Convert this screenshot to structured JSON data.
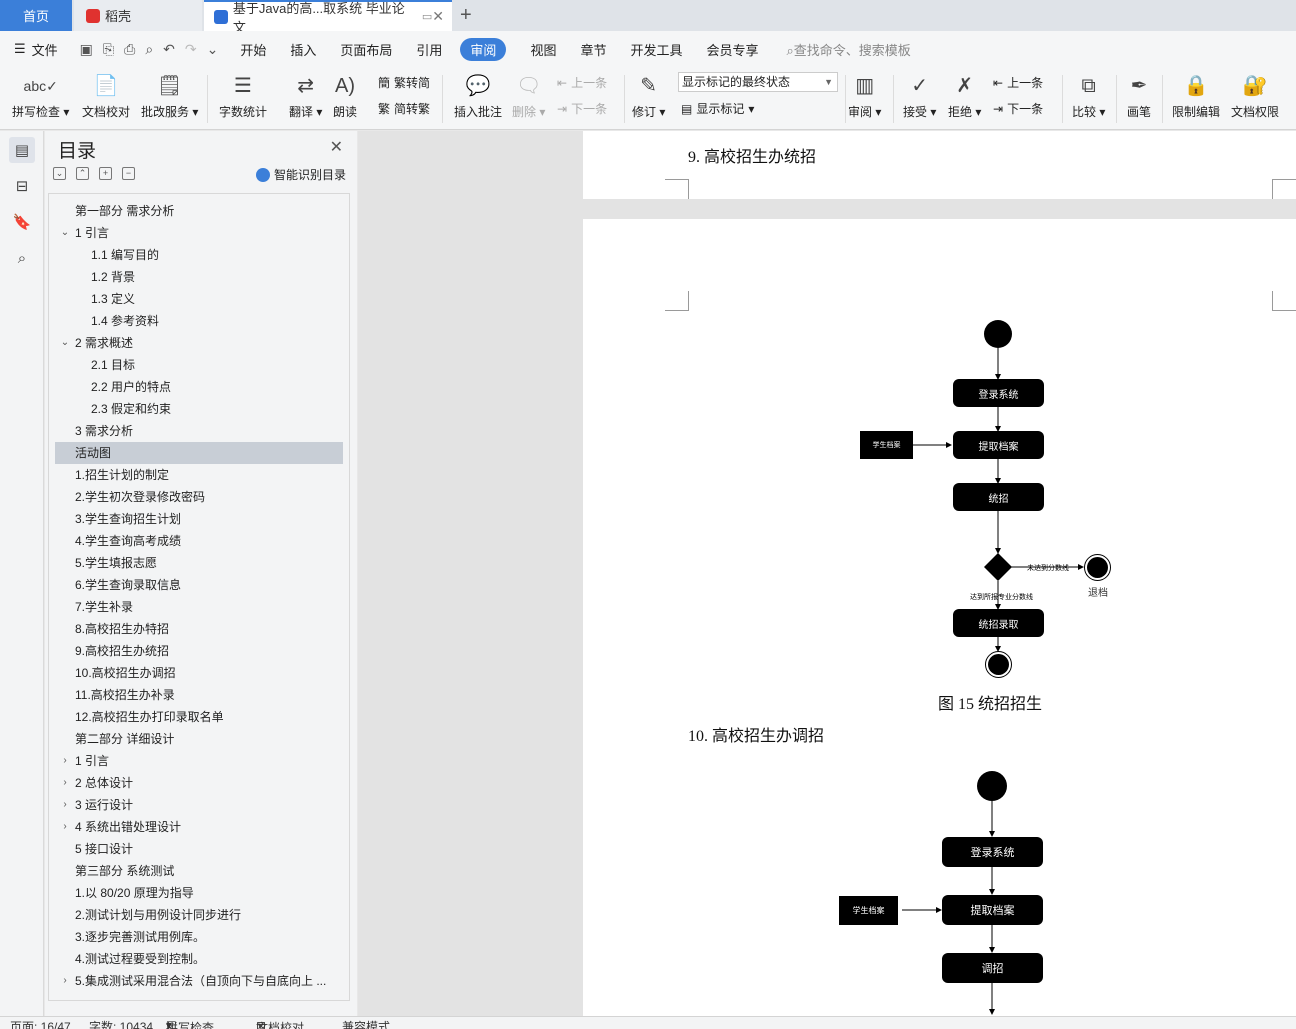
{
  "tabs": {
    "home": "首页",
    "daoke": "稻壳",
    "doc": "基于Java的高...取系统 毕业论文"
  },
  "menu": {
    "file": "文件",
    "items": [
      "开始",
      "插入",
      "页面布局",
      "引用",
      "审阅",
      "视图",
      "章节",
      "开发工具",
      "会员专享"
    ],
    "active": "审阅",
    "search": "查找命令、搜索模板"
  },
  "ribbon": {
    "spell": "拼写检查",
    "doc_check": "文档校对",
    "revise_service": "批改服务",
    "word_count": "字数统计",
    "translate": "翻译",
    "read": "朗读",
    "trad_simp": "繁转简",
    "simp_trad": "简转繁",
    "insert_comment": "插入批注",
    "delete": "删除",
    "prev": "上一条",
    "next": "下一条",
    "track": "修订",
    "markup_state": "显示标记的最终状态",
    "show_markup": "显示标记",
    "review": "审阅",
    "accept": "接受",
    "reject": "拒绝",
    "prev2": "上一条",
    "next2": "下一条",
    "compare": "比较",
    "pen": "画笔",
    "restrict": "限制编辑",
    "permission": "文档权限"
  },
  "toc": {
    "title": "目录",
    "ai_label": "智能识别目录",
    "items": [
      {
        "text": "第一部分  需求分析",
        "level": 0,
        "chev": ""
      },
      {
        "text": "1    引言",
        "level": 0,
        "chev": "down"
      },
      {
        "text": "1.1    编写目的",
        "level": 1,
        "chev": ""
      },
      {
        "text": "1.2  背景",
        "level": 1,
        "chev": ""
      },
      {
        "text": "1.3    定义",
        "level": 1,
        "chev": ""
      },
      {
        "text": "1.4    参考资料",
        "level": 1,
        "chev": ""
      },
      {
        "text": "2    需求概述",
        "level": 0,
        "chev": "down"
      },
      {
        "text": "2.1  目标",
        "level": 1,
        "chev": ""
      },
      {
        "text": "2.2    用户的特点",
        "level": 1,
        "chev": ""
      },
      {
        "text": "2.3    假定和约束",
        "level": 1,
        "chev": ""
      },
      {
        "text": "3  需求分析",
        "level": 0,
        "chev": ""
      },
      {
        "text": "活动图",
        "level": 0,
        "chev": "",
        "selected": true
      },
      {
        "text": "1.招生计划的制定",
        "level": 0,
        "chev": ""
      },
      {
        "text": "2.学生初次登录修改密码",
        "level": 0,
        "chev": ""
      },
      {
        "text": "3.学生查询招生计划",
        "level": 0,
        "chev": ""
      },
      {
        "text": "4.学生查询高考成绩",
        "level": 0,
        "chev": ""
      },
      {
        "text": "5.学生填报志愿",
        "level": 0,
        "chev": ""
      },
      {
        "text": "6.学生查询录取信息",
        "level": 0,
        "chev": ""
      },
      {
        "text": "7.学生补录",
        "level": 0,
        "chev": ""
      },
      {
        "text": "8.高校招生办特招",
        "level": 0,
        "chev": ""
      },
      {
        "text": "9.高校招生办统招",
        "level": 0,
        "chev": ""
      },
      {
        "text": "10.高校招生办调招",
        "level": 0,
        "chev": ""
      },
      {
        "text": "11.高校招生办补录",
        "level": 0,
        "chev": ""
      },
      {
        "text": "12.高校招生办打印录取名单",
        "level": 0,
        "chev": ""
      },
      {
        "text": "第二部分  详细设计",
        "level": 0,
        "chev": ""
      },
      {
        "text": "1  引言",
        "level": 0,
        "chev": "right"
      },
      {
        "text": "2  总体设计",
        "level": 0,
        "chev": "right"
      },
      {
        "text": "3  运行设计",
        "level": 0,
        "chev": "right"
      },
      {
        "text": "4  系统出错处理设计",
        "level": 0,
        "chev": "right"
      },
      {
        "text": "5  接口设计",
        "level": 0,
        "chev": ""
      },
      {
        "text": "第三部分  系统测试",
        "level": 0,
        "chev": ""
      },
      {
        "text": "1.以  80/20  原理为指导",
        "level": 0,
        "chev": ""
      },
      {
        "text": "2.测试计划与用例设计同步进行",
        "level": 0,
        "chev": ""
      },
      {
        "text": "3.逐步完善测试用例库。",
        "level": 0,
        "chev": ""
      },
      {
        "text": "4.测试过程要受到控制。",
        "level": 0,
        "chev": ""
      },
      {
        "text": "5.集成测试采用混合法（自顶向下与自底向上 ...",
        "level": 0,
        "chev": "right"
      }
    ]
  },
  "doc": {
    "heading9": "9.  高校招生办统招",
    "heading10": "10. 高校招生办调招",
    "caption15": "图 15  统招招生",
    "diagram1": {
      "login": "登录系统",
      "fetch": "提取档案",
      "student_file": "学生档案",
      "unified": "统招",
      "not_reached": "未达到分数线",
      "reached": "达到所报专业分数线",
      "return_file": "退档",
      "admit": "统招录取"
    },
    "diagram2": {
      "login": "登录系统",
      "fetch": "提取档案",
      "student_file": "学生档案",
      "adjust": "调招"
    }
  },
  "status": {
    "page": "页面: 16/47",
    "words": "字数: 10434",
    "spell": "拼写检查",
    "check": "文档校对",
    "compat": "兼容模式"
  }
}
